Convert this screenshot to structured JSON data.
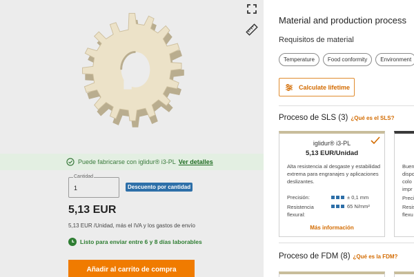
{
  "viewer": {
    "fullscreen_icon": "fullscreen-icon",
    "ruler_icon": "ruler-icon"
  },
  "fabrication": {
    "text": "Puede fabricarse con iglidur® i3-PL",
    "link": "Ver detalles"
  },
  "quantity": {
    "label": "Cantidad",
    "value": "1"
  },
  "discount_badge": "Descuento por cantidad",
  "price": "5,13 EUR",
  "price_note": "5,13 EUR /Unidad, más el IVA y los gastos de envío",
  "shipping": "Listo para enviar entre 6 y 8 días laborables",
  "cart_button": "Añadir al carrito de compra",
  "right": {
    "title": "Material and production process",
    "requirements_label": "Requisitos de material",
    "chips": [
      "Temperature",
      "Food conformity",
      "Environment"
    ],
    "calculate_button": "Calculate lifetime",
    "sls": {
      "title": "Proceso de SLS (3)",
      "question": "¿Qué es el SLS?",
      "card": {
        "name": "iglidur® i3-PL",
        "price": "5,13 EUR/Unidad",
        "description": "Alta resistencia al desgaste y estabilidad extrema para engranajes y aplicaciones deslizantes.",
        "precision_label": "Precisión:",
        "precision_value": "± 0,1 mm",
        "resistance_label": "Resistencia flexural:",
        "resistance_value": "65 N/mm²",
        "more": "Más información"
      },
      "card2_lines": [
        "Buen",
        "dispo",
        "colo",
        "impr"
      ],
      "card2_lines2": [
        "Preci",
        "Resis",
        "flexu"
      ]
    },
    "fdm": {
      "title": "Proceso de FDM (8)",
      "question": "¿Qué es la FDM?"
    }
  },
  "colors": {
    "accent": "#f07b00",
    "success": "#2e7d32",
    "badge": "#2d6fa8"
  }
}
